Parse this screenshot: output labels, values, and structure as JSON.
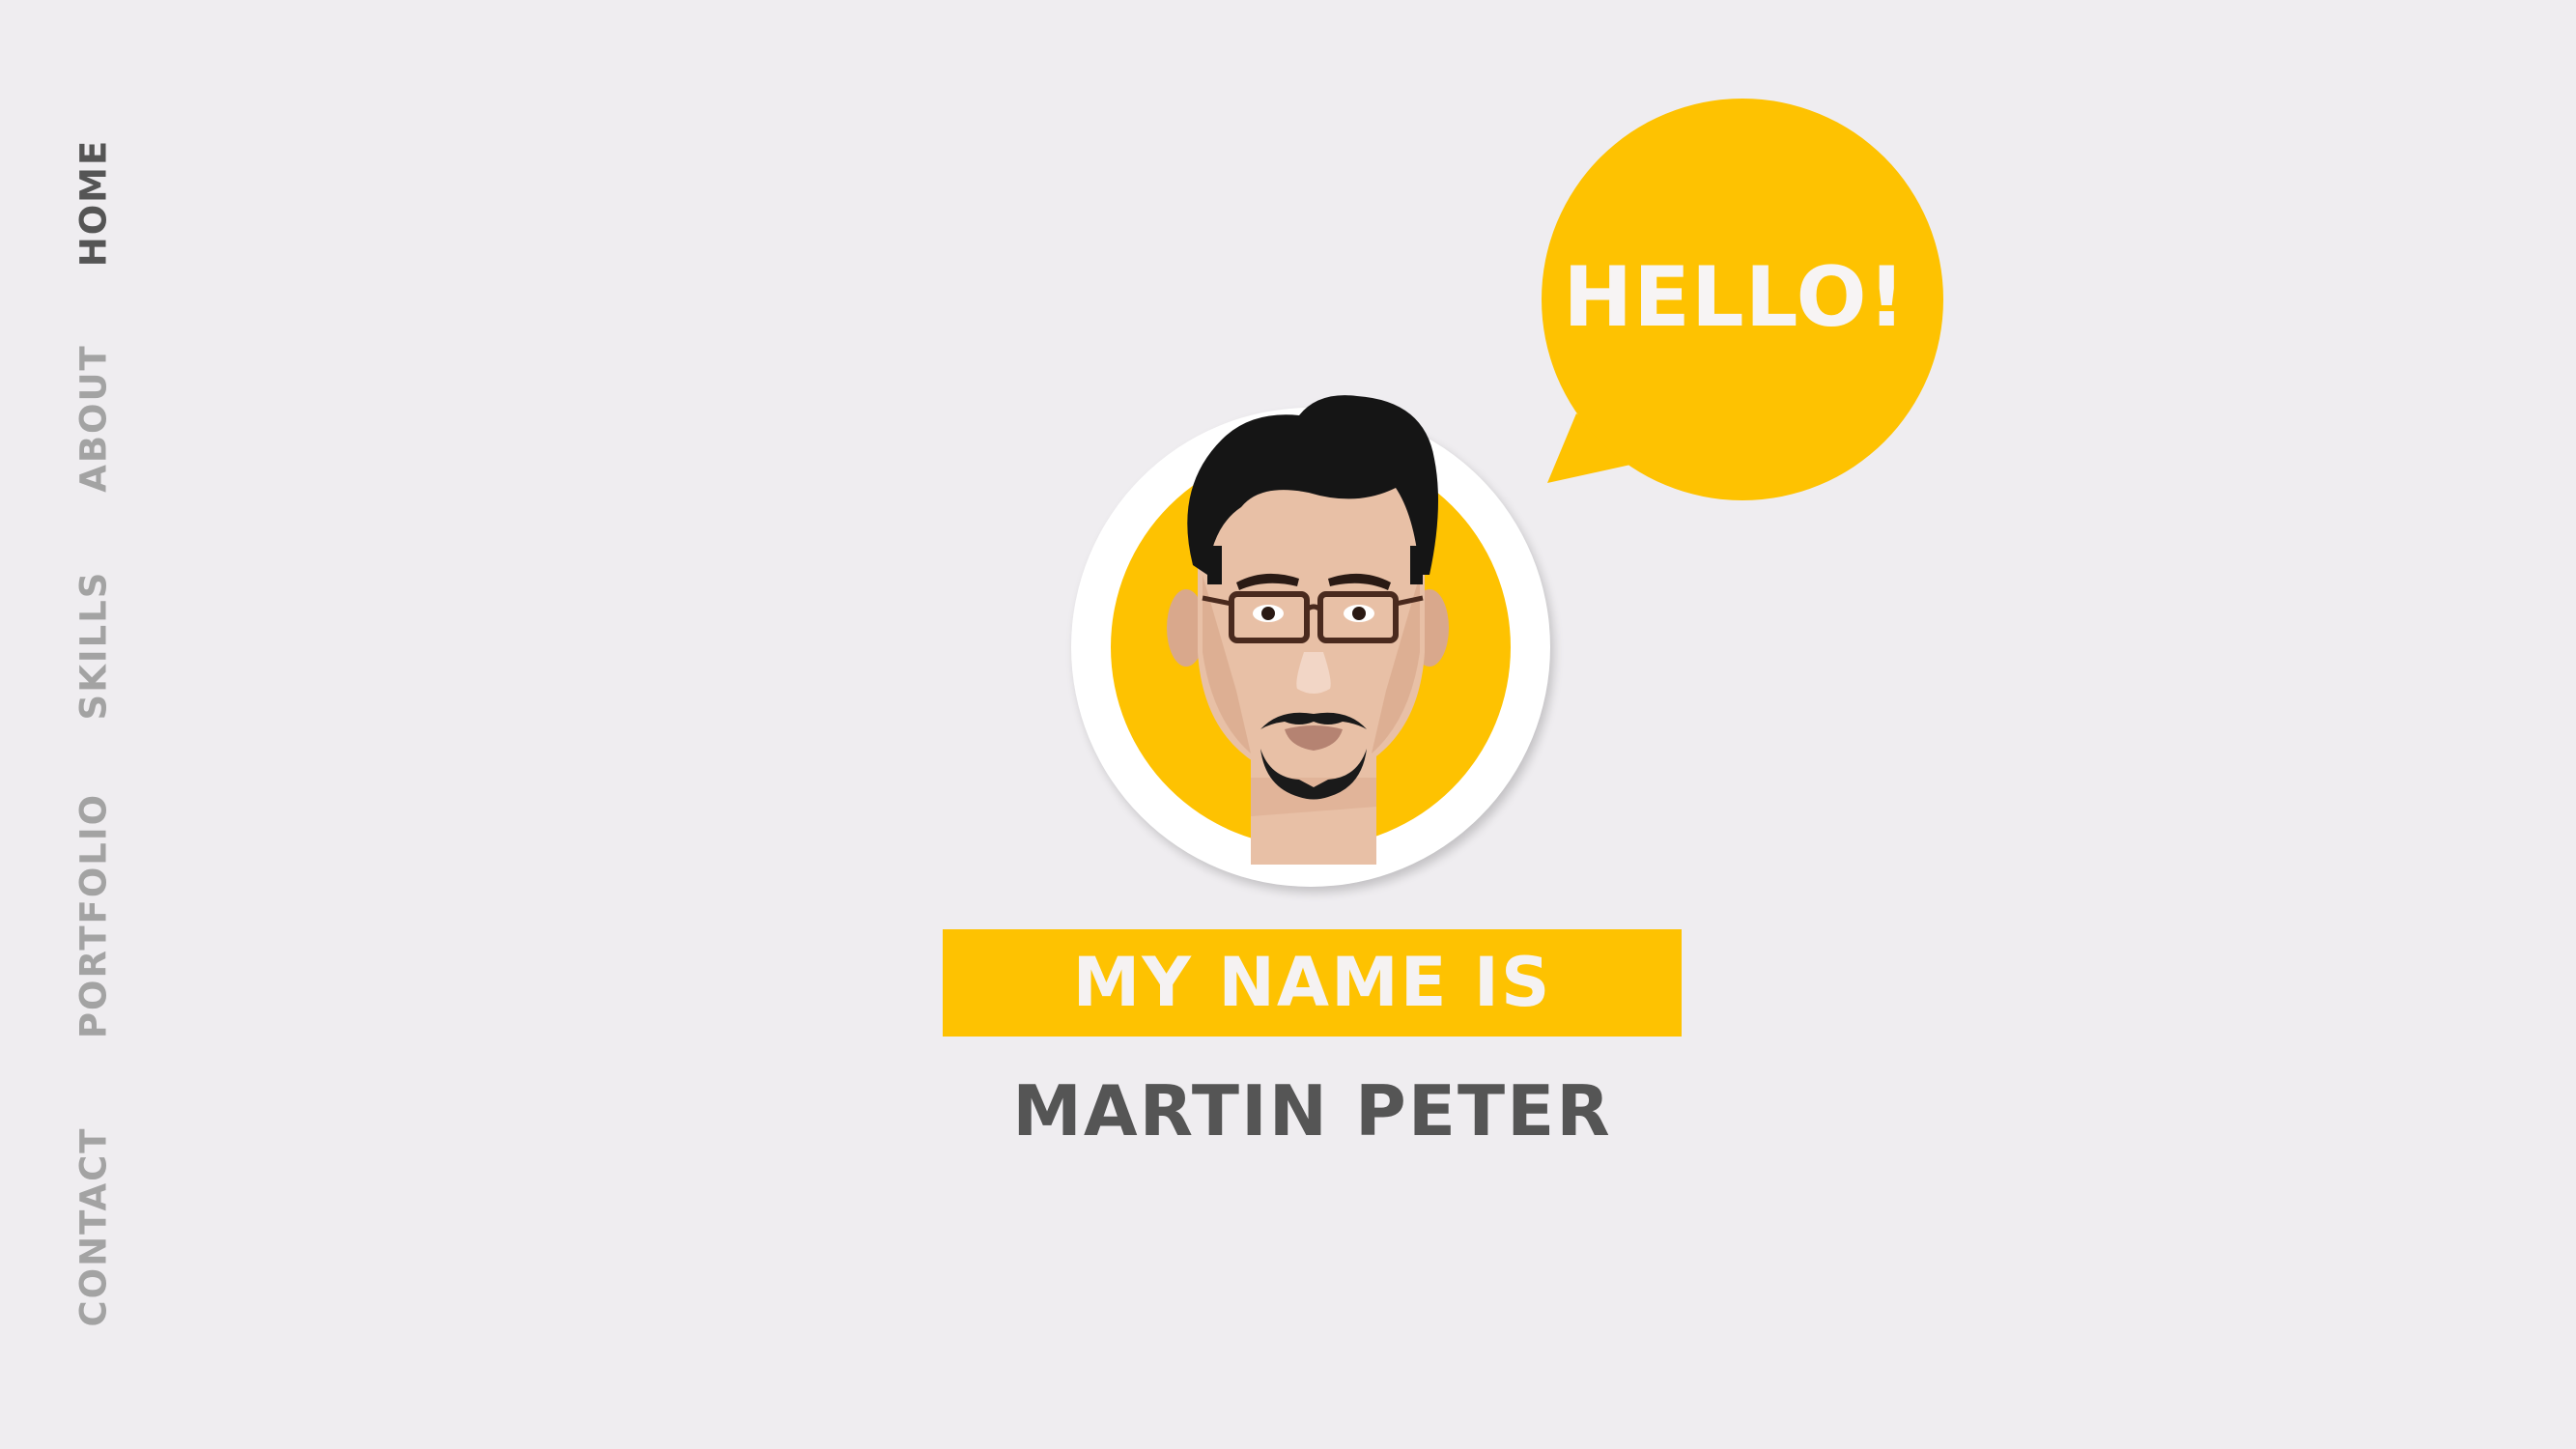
{
  "nav": {
    "items": [
      {
        "label": "HOME",
        "active": true
      },
      {
        "label": "ABOUT",
        "active": false
      },
      {
        "label": "SKILLS",
        "active": false
      },
      {
        "label": "PORTFOLIO",
        "active": false
      },
      {
        "label": "CONTACT",
        "active": false
      }
    ]
  },
  "hero": {
    "greeting": "HELLO!",
    "intro_label": "MY NAME IS",
    "name": "MARTIN PETER"
  },
  "colors": {
    "background": "#efedf0",
    "accent": "#fec201",
    "nav_active": "#555555",
    "nav_inactive": "#a3a3a3",
    "name_text": "#555555"
  },
  "icons": {
    "avatar": "hipster-avatar-illustration",
    "bubble": "speech-bubble"
  }
}
